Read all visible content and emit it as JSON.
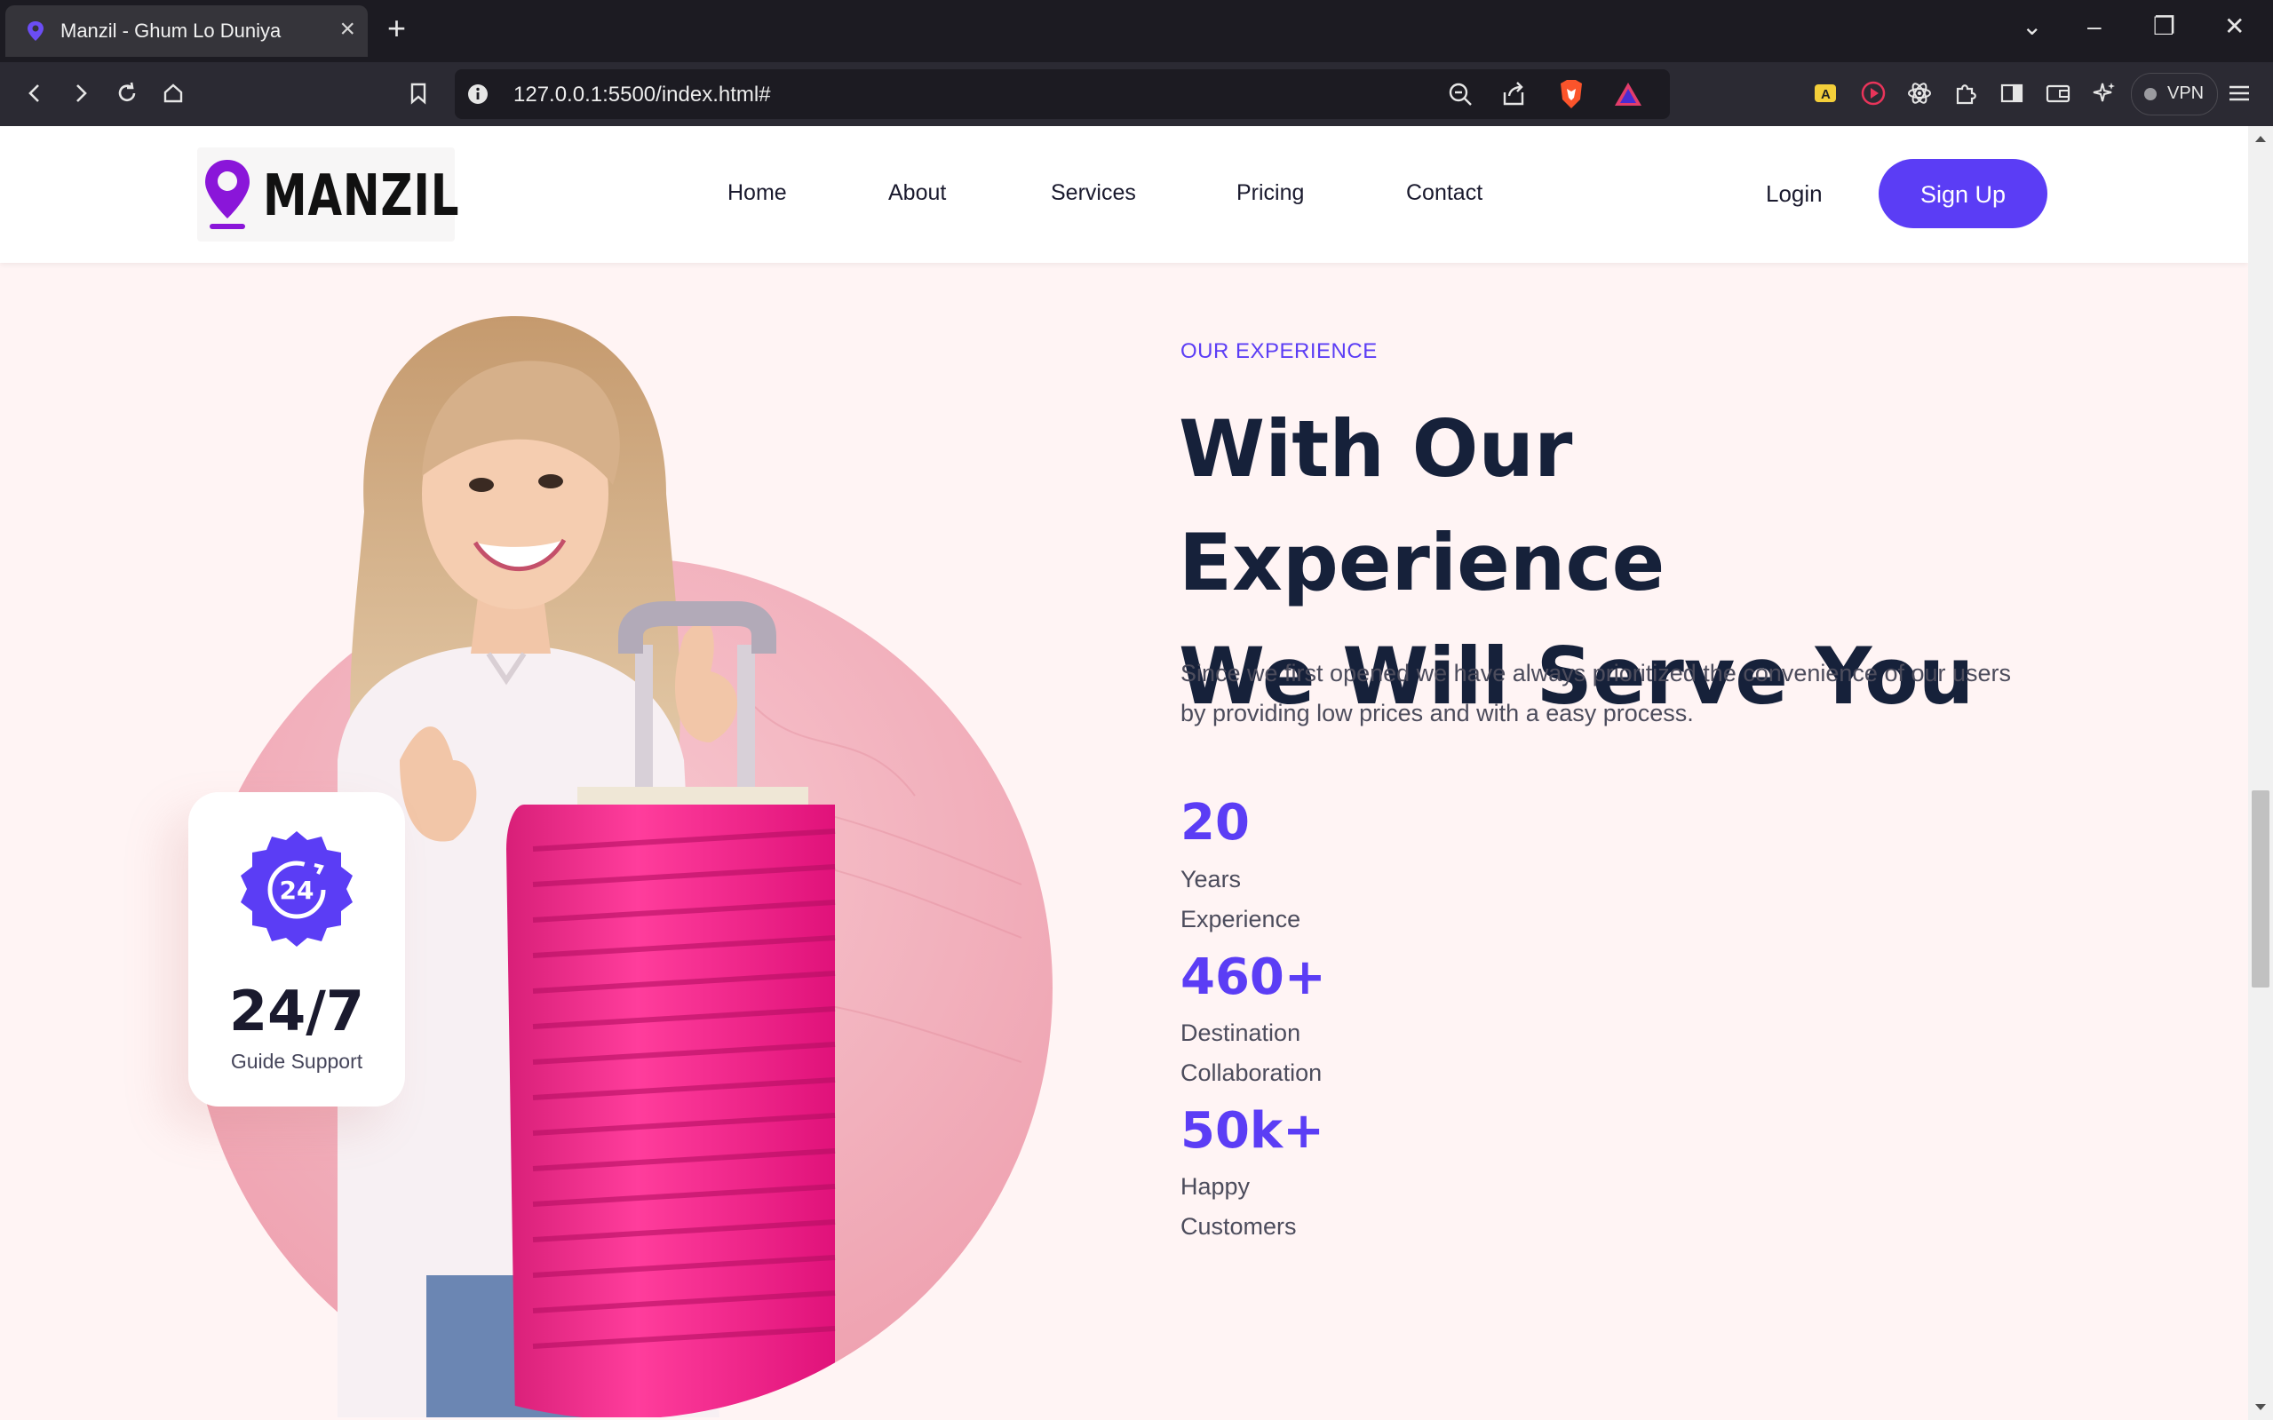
{
  "browser": {
    "tab_title": "Manzil - Ghum Lo Duniya",
    "url": "127.0.0.1:5500/index.html#",
    "vpn_label": "VPN"
  },
  "site": {
    "logo_text": "MANZIL",
    "nav": [
      "Home",
      "About",
      "Services",
      "Pricing",
      "Contact"
    ],
    "login_label": "Login",
    "signup_label": "Sign Up",
    "accent_color": "#5b3df5",
    "heading_color": "#16213a"
  },
  "hero": {
    "badge_icon_text": "24",
    "badge_number": "24/7",
    "badge_label": "Guide Support",
    "eyebrow": "OUR EXPERIENCE",
    "headline_line1": "With Our Experience",
    "headline_line2": "We Will Serve You",
    "description": "Since we first opened we have always prioritized the convenience of our users by providing low prices and with a easy process.",
    "stats": [
      {
        "number": "20",
        "line1": "Years",
        "line2": "Experience"
      },
      {
        "number": "460+",
        "line1": "Destination",
        "line2": "Collaboration"
      },
      {
        "number": "50k+",
        "line1": "Happy",
        "line2": "Customers"
      }
    ]
  }
}
